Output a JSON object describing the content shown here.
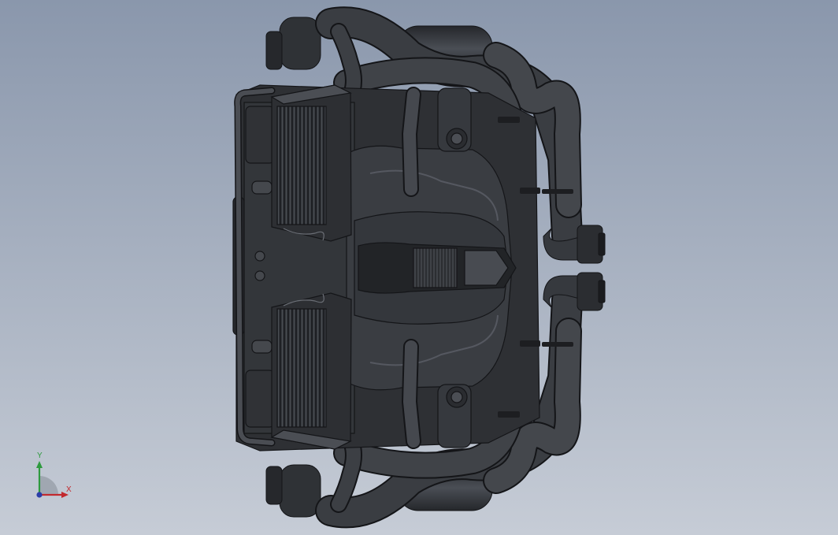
{
  "viewport": {
    "background_top": "#8a97ac",
    "background_bottom": "#c6ccd6",
    "model_dark": "#2b2d31",
    "model_mid": "#3d4045",
    "model_light": "#5a5e65",
    "edge_line": "#141518"
  },
  "triad": {
    "x_label": "X",
    "y_label": "Y",
    "x_color": "#c2292e",
    "y_color": "#2e9a3e",
    "z_color": "#2b3ea8"
  }
}
